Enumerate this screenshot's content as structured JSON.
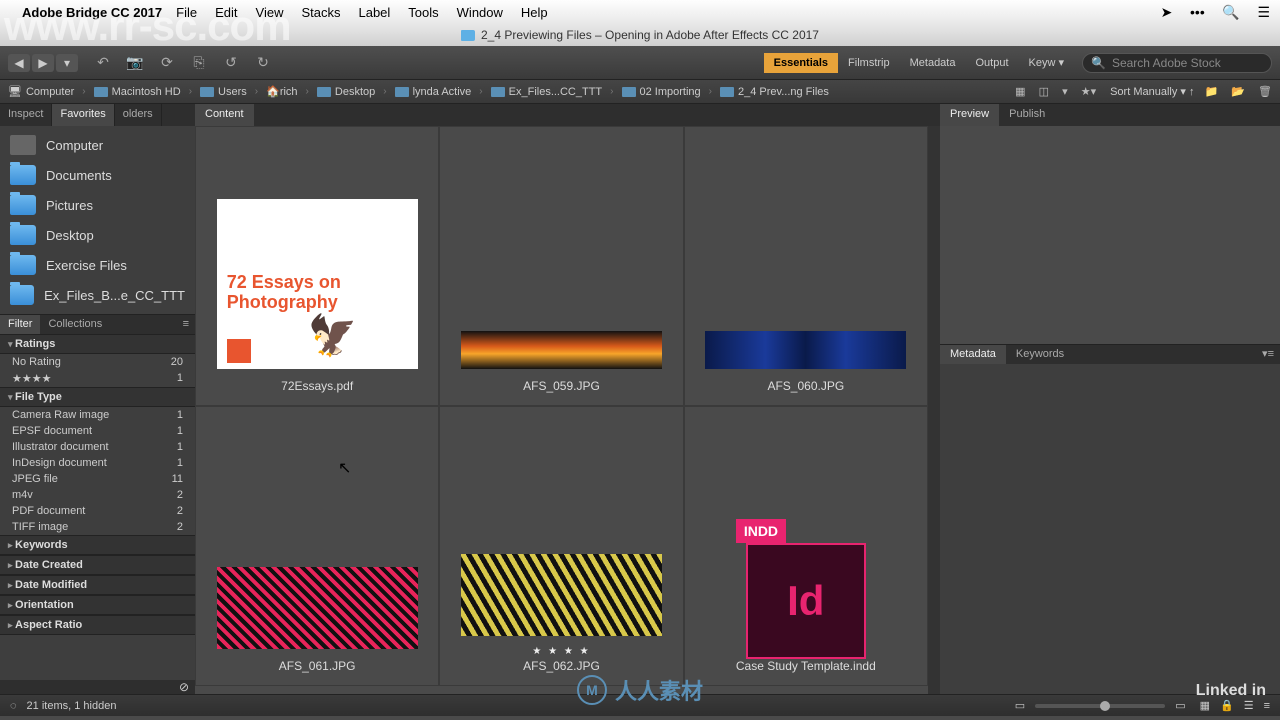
{
  "menubar": {
    "app": "Adobe Bridge CC 2017",
    "items": [
      "File",
      "Edit",
      "View",
      "Stacks",
      "Label",
      "Tools",
      "Window",
      "Help"
    ]
  },
  "titlebar": "2_4 Previewing Files – Opening in Adobe After Effects CC 2017",
  "workspaces": {
    "active": "Essentials",
    "others": [
      "Filmstrip",
      "Metadata",
      "Output",
      "Keyw"
    ]
  },
  "search_placeholder": "Search Adobe Stock",
  "path": [
    "Computer",
    "Macintosh HD",
    "Users",
    "rich",
    "Desktop",
    "lynda Active",
    "Ex_Files...CC_TTT",
    "02 Importing",
    "2_4 Prev...ng Files"
  ],
  "sort": "Sort Manually",
  "left_tabs": {
    "a": "Inspect",
    "b": "Favorites",
    "c": "olders",
    "active": "Favorites"
  },
  "favorites": [
    {
      "label": "Computer",
      "type": "monitor"
    },
    {
      "label": "Documents",
      "type": "folder"
    },
    {
      "label": "Pictures",
      "type": "folder"
    },
    {
      "label": "Desktop",
      "type": "folder"
    },
    {
      "label": "Exercise Files",
      "type": "folder"
    },
    {
      "label": "Ex_Files_B...e_CC_TTT",
      "type": "folder"
    }
  ],
  "filter_tabs": {
    "a": "Filter",
    "b": "Collections",
    "active": "Filter"
  },
  "filters": {
    "ratings": {
      "title": "Ratings",
      "rows": [
        {
          "n": "No Rating",
          "c": "20"
        },
        {
          "n": "★★★★",
          "c": "1"
        }
      ]
    },
    "filetype": {
      "title": "File Type",
      "rows": [
        {
          "n": "Camera Raw image",
          "c": "1"
        },
        {
          "n": "EPSF document",
          "c": "1"
        },
        {
          "n": "Illustrator document",
          "c": "1"
        },
        {
          "n": "InDesign document",
          "c": "1"
        },
        {
          "n": "JPEG file",
          "c": "11"
        },
        {
          "n": "m4v",
          "c": "2"
        },
        {
          "n": "PDF document",
          "c": "2"
        },
        {
          "n": "TIFF image",
          "c": "2"
        }
      ]
    },
    "closed": [
      "Keywords",
      "Date Created",
      "Date Modified",
      "Orientation",
      "Aspect Ratio"
    ]
  },
  "content_tab": "Content",
  "files": [
    {
      "name": "72Essays.pdf",
      "kind": "pdf",
      "pdf_title": "72 Essays on Photography"
    },
    {
      "name": "AFS_059.JPG",
      "kind": "img",
      "cls": "t059"
    },
    {
      "name": "AFS_060.JPG",
      "kind": "img",
      "cls": "t060"
    },
    {
      "name": "AFS_061.JPG",
      "kind": "img2",
      "cls": "t061"
    },
    {
      "name": "AFS_062.JPG",
      "kind": "img2",
      "cls": "t062",
      "stars": "★ ★ ★ ★"
    },
    {
      "name": "Case Study Template.indd",
      "kind": "indd",
      "tag": "INDD",
      "id": "Id"
    }
  ],
  "preview_tabs": {
    "a": "Preview",
    "b": "Publish",
    "active": "Preview"
  },
  "meta_tabs": {
    "a": "Metadata",
    "b": "Keywords",
    "active": "Metadata"
  },
  "status": "21 items, 1 hidden",
  "watermark": "www.rr-sc.com",
  "renren": "人人素材",
  "linkedin": "Linked in"
}
